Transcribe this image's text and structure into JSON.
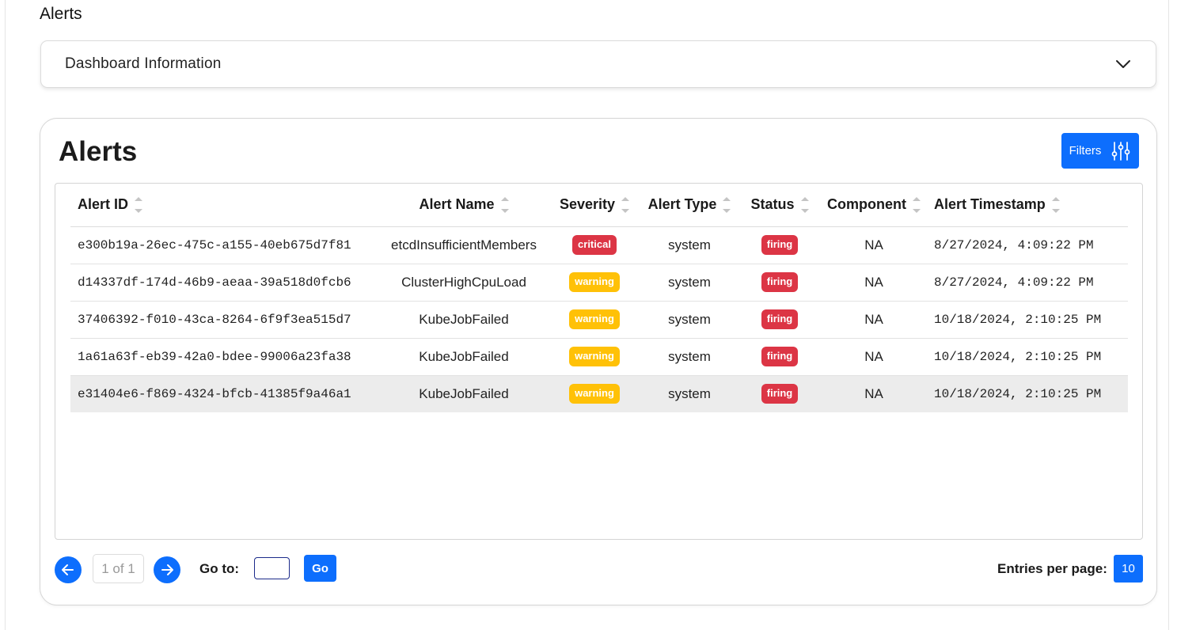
{
  "page": {
    "title": "Alerts"
  },
  "dashboard_info": {
    "label": "Dashboard Information"
  },
  "alerts_card": {
    "title": "Alerts",
    "filters_label": "Filters",
    "columns": [
      "Alert ID",
      "Alert Name",
      "Severity",
      "Alert Type",
      "Status",
      "Component",
      "Alert Timestamp"
    ],
    "rows": [
      {
        "id": "e300b19a-26ec-475c-a155-40eb675d7f81",
        "name": "etcdInsufficientMembers",
        "severity": "critical",
        "type": "system",
        "status": "firing",
        "component": "NA",
        "timestamp": "8/27/2024, 4:09:22 PM"
      },
      {
        "id": "d14337df-174d-46b9-aeaa-39a518d0fcb6",
        "name": "ClusterHighCpuLoad",
        "severity": "warning",
        "type": "system",
        "status": "firing",
        "component": "NA",
        "timestamp": "8/27/2024, 4:09:22 PM"
      },
      {
        "id": "37406392-f010-43ca-8264-6f9f3ea515d7",
        "name": "KubeJobFailed",
        "severity": "warning",
        "type": "system",
        "status": "firing",
        "component": "NA",
        "timestamp": "10/18/2024, 2:10:25 PM"
      },
      {
        "id": "1a61a63f-eb39-42a0-bdee-99006a23fa38",
        "name": "KubeJobFailed",
        "severity": "warning",
        "type": "system",
        "status": "firing",
        "component": "NA",
        "timestamp": "10/18/2024, 2:10:25 PM"
      },
      {
        "id": "e31404e6-f869-4324-bfcb-41385f9a46a1",
        "name": "KubeJobFailed",
        "severity": "warning",
        "type": "system",
        "status": "firing",
        "component": "NA",
        "timestamp": "10/18/2024, 2:10:25 PM"
      }
    ]
  },
  "pagination": {
    "page_indicator": "1 of 1",
    "goto_label": "Go to:",
    "goto_value": "",
    "go_label": "Go",
    "entries_label": "Entries per page:",
    "entries_value": "10"
  },
  "colors": {
    "primary": "#0d6efd",
    "critical": "#dc3545",
    "warning": "#ffc107",
    "firing": "#dc3545",
    "row_highlight": "#ececec"
  },
  "icons": {
    "dashboard_toggle": "chevron-down-icon",
    "filters": "sliders-icon",
    "sort": "sort-icon",
    "prev": "arrow-left-icon",
    "next": "arrow-right-icon"
  }
}
